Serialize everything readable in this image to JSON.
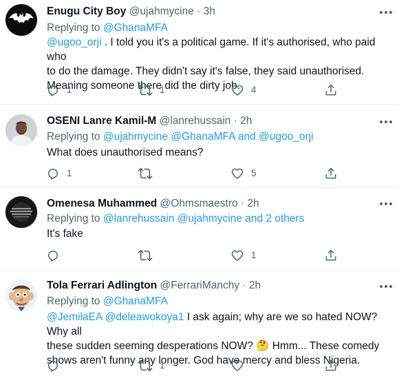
{
  "tweets": [
    {
      "name": "Enugu City Boy",
      "handle": "@ujahmycine",
      "dot": "·",
      "time": "3h",
      "replying_label": "Replying to",
      "replying_links": [
        "@GhanaMFA"
      ],
      "text_mention": "@ugoo_orji",
      "text_line1": " . I told you it's a political game. If it's authorised, who paid who",
      "text_line2": "to do the damage. They didn't say it's false, they said unauthorised.",
      "text_line3": "Meaning someone there did the dirty job.",
      "replies": "1",
      "retweets": "1",
      "likes": "4"
    },
    {
      "name": "OSENI Lanre Kamil-M",
      "handle": "@lanrehussain",
      "dot": "·",
      "time": "2h",
      "replying_label": "Replying to",
      "replying_links": [
        "@ujahmycine",
        "@GhanaMFA",
        "@ugoo_orji"
      ],
      "replying_and": "and",
      "text": "What does unauthorised means?",
      "replies": "1",
      "retweets": "",
      "likes": "5"
    },
    {
      "name": "Omenesa Muhammed",
      "handle": "@Ohmsmaestro",
      "dot": "·",
      "time": "2h",
      "replying_label": "Replying to",
      "replying_links": [
        "@lanrehussain",
        "@ujahmycine",
        "2 others"
      ],
      "replying_and": "and",
      "text": "It's fake",
      "replies": "",
      "retweets": "",
      "likes": "1"
    },
    {
      "name": "Tola Ferrari Adlington",
      "handle": "@FerrariManchy",
      "dot": "·",
      "time": "2h",
      "replying_label": "Replying to",
      "replying_links": [
        "@GhanaMFA"
      ],
      "text_mentions": [
        "@JemilaEA",
        "@deleawokoya1"
      ],
      "text_line1": " I ask again; why are we so hated NOW? Why all",
      "text_line2a": "these sudden seeming desperations NOW?",
      "text_emoji": "🤔",
      "text_line2b": " Hmm... These comedy",
      "text_line3": "shows aren't funny any longer. God have mercy and bless Nigeria.",
      "replies": "",
      "retweets": "1",
      "likes": ""
    }
  ],
  "icons": {
    "reply": "reply-icon",
    "retweet": "retweet-icon",
    "like": "like-icon",
    "share": "share-icon",
    "more": "more-icon"
  },
  "colors": {
    "link": "#1d9bf0",
    "secondary": "#536471",
    "text": "#0f1419",
    "divider": "#e6ecf0"
  }
}
